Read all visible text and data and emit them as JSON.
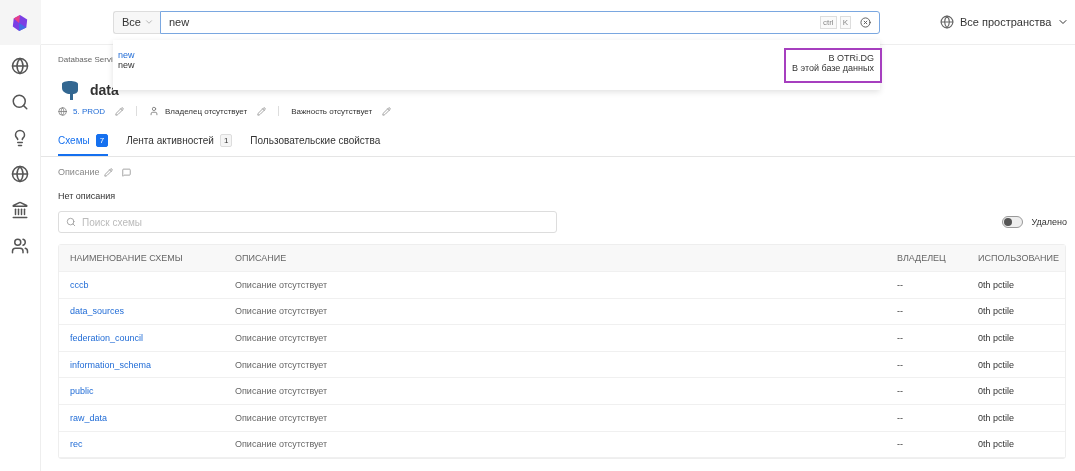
{
  "search": {
    "scope": "Все",
    "value": "new",
    "shortcut": [
      "ctrl",
      "K"
    ]
  },
  "spaces": {
    "label": "Все пространства"
  },
  "suggestion": {
    "title": "new",
    "subtitle": "new",
    "source": "В OTRi.DG",
    "scope": "В этой базе данных",
    "highlighted": true
  },
  "breadcrumb": "Database Servi",
  "title": "data",
  "meta": [
    {
      "kind": "tier",
      "text": "5. PROD"
    },
    {
      "kind": "owner",
      "text": "Владелец отсутствует"
    },
    {
      "kind": "importance",
      "text": "Важность отсутствует"
    }
  ],
  "tabs": [
    {
      "label": "Схемы",
      "count": "7",
      "selected": true
    },
    {
      "label": "Лента активностей",
      "count": "1",
      "selected": false
    },
    {
      "label": "Пользовательские свойства",
      "selected": false
    }
  ],
  "description": {
    "label": "Описание",
    "text": "Нет описания"
  },
  "schema_search": {
    "placeholder": "Поиск схемы"
  },
  "deleted_toggle": {
    "label": "Удалено",
    "on": false
  },
  "table": {
    "columns": [
      "НАИМЕНОВАНИЕ СХЕМЫ",
      "ОПИСАНИЕ",
      "ВЛАДЕЛЕЦ",
      "ИСПОЛЬЗОВАНИЕ"
    ],
    "rows": [
      {
        "name": "cccb",
        "description": "Описание отсутствует",
        "owner": "--",
        "usage": "0th pctile"
      },
      {
        "name": "data_sources",
        "description": "Описание отсутствует",
        "owner": "--",
        "usage": "0th pctile"
      },
      {
        "name": "federation_council",
        "description": "Описание отсутствует",
        "owner": "--",
        "usage": "0th pctile"
      },
      {
        "name": "information_schema",
        "description": "Описание отсутствует",
        "owner": "--",
        "usage": "0th pctile"
      },
      {
        "name": "public",
        "description": "Описание отсутствует",
        "owner": "--",
        "usage": "0th pctile"
      },
      {
        "name": "raw_data",
        "description": "Описание отсутствует",
        "owner": "--",
        "usage": "0th pctile"
      },
      {
        "name": "rec",
        "description": "Описание отсутствует",
        "owner": "--",
        "usage": "0th pctile"
      }
    ]
  }
}
